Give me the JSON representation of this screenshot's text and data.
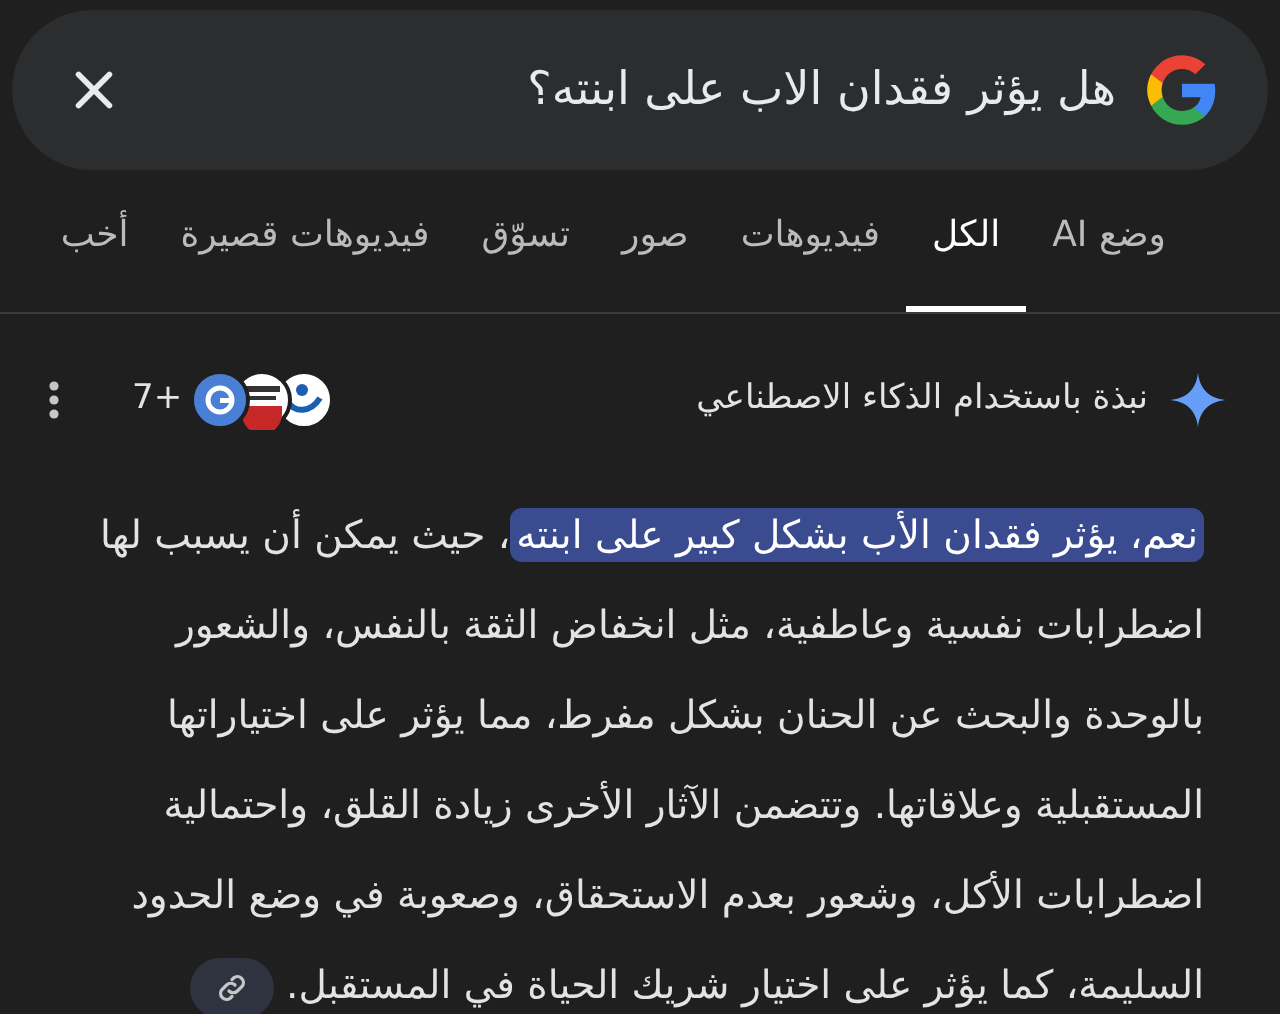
{
  "search": {
    "value": "هل يؤثر فقدان الاب على ابنته؟"
  },
  "tabs": [
    {
      "label": "وضع AI",
      "selected": false
    },
    {
      "label": "الكل",
      "selected": true
    },
    {
      "label": "فيديوهات",
      "selected": false
    },
    {
      "label": "صور",
      "selected": false
    },
    {
      "label": "تسوّق",
      "selected": false
    },
    {
      "label": "فيديوهات قصيرة",
      "selected": false
    },
    {
      "label": "أخب",
      "selected": false
    }
  ],
  "overview": {
    "title": "نبذة باستخدام الذكاء الاصطناعي",
    "sources_count": "7+",
    "highlight": "نعم، يؤثر فقدان الأب بشكل كبير على ابنته",
    "text": "، حيث يمكن أن يسبب لها اضطرابات نفسية وعاطفية، مثل انخفاض الثقة بالنفس، والشعور بالوحدة والبحث عن الحنان بشكل مفرط، مما يؤثر على اختياراتها المستقبلية وعلاقاتها. وتتضمن الآثار الأخرى زيادة القلق، واحتمالية اضطرابات الأكل، وشعور بعدم الاستحقاق، وصعوبة في وضع الحدود السليمة، كما يؤثر على اختيار شريك الحياة في المستقبل."
  }
}
